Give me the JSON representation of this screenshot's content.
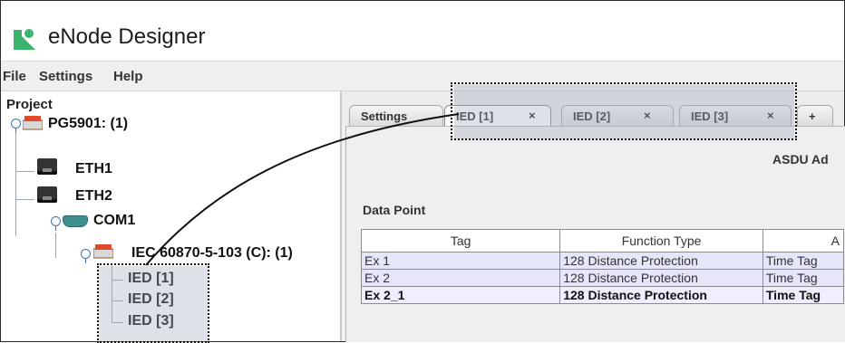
{
  "app": {
    "title": "eNode Designer",
    "logo_icon": "enode-logo-icon"
  },
  "menubar": {
    "items": [
      "File",
      "Settings",
      "Help"
    ]
  },
  "project_tree": {
    "title": "Project",
    "device": "PG5901: (1)",
    "eth1": "ETH1",
    "eth2": "ETH2",
    "com1": "COM1",
    "protocol": "IEC 60870-5-103 (C): (1)",
    "ied1": "IED [1]",
    "ied2": "IED [2]",
    "ied3": "IED [3]"
  },
  "tabs": {
    "settings": "Settings",
    "ied1": "IED [1]",
    "ied2": "IED [2]",
    "ied3": "IED [3]",
    "close_glyph": "×",
    "add_glyph": "+"
  },
  "main": {
    "asdu_label": "ASDU Ad",
    "data_point_label": "Data Point",
    "table": {
      "headers": [
        "Tag",
        "Function Type",
        "A"
      ],
      "rows": [
        [
          "Ex 1",
          "128 Distance Protection",
          "Time Tag"
        ],
        [
          "Ex 2",
          "128 Distance Protection",
          "Time Tag"
        ],
        [
          "Ex 2_1",
          "128 Distance Protection",
          "Time Tag"
        ]
      ]
    }
  },
  "colors": {
    "row_highlight": "#e6e6fb",
    "tree_toggle": "#3a73b5",
    "logo_green": "#3cb46e"
  }
}
